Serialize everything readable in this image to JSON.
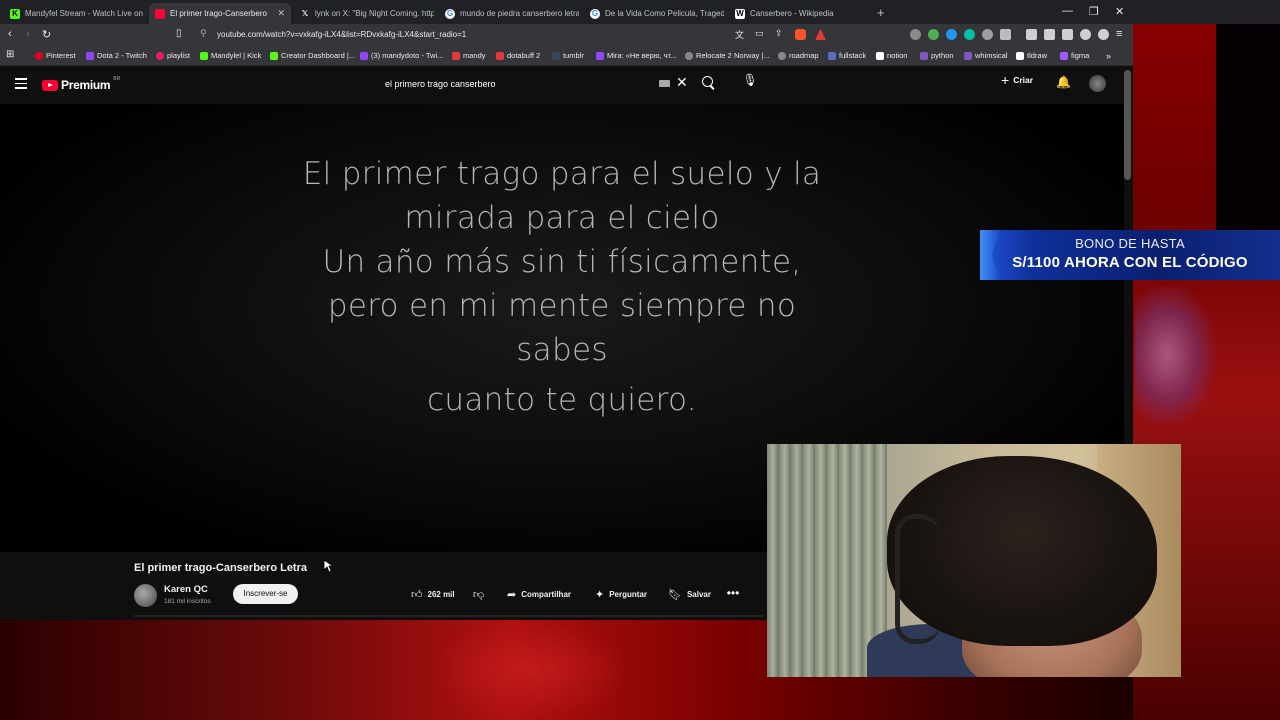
{
  "browser": {
    "tabs": [
      {
        "title": "Mandyfel Stream - Watch Live on Kick",
        "icon": "kick-icon",
        "color": "#53fc18"
      },
      {
        "title": "El primer trago-Canserbero Letra",
        "icon": "youtube-icon",
        "color": "#ff0033",
        "active": true
      },
      {
        "title": "lynk on X: \"Big Night Coming. https:",
        "icon": "x-icon",
        "color": "#ffffff"
      },
      {
        "title": "mundo de piedra canserbero letra -",
        "icon": "google-icon",
        "color": "#ffffff"
      },
      {
        "title": "De la Vida Como Pelicula, Tragedia, C",
        "icon": "google-icon",
        "color": "#ffffff"
      },
      {
        "title": "Canserbero - Wikipedia",
        "icon": "wikipedia-icon",
        "color": "#ffffff"
      }
    ],
    "url": "youtube.com/watch?v=vxkafg-iLX4&list=RDvxkafg-iLX4&start_radio=1",
    "bookmarks": [
      {
        "label": "Pinterest",
        "color": "#e60023"
      },
      {
        "label": "Dota 2 - Twitch",
        "color": "#9146ff"
      },
      {
        "label": "playlist",
        "color": "#e91e63"
      },
      {
        "label": "Mandylel | Kick",
        "color": "#53fc18"
      },
      {
        "label": "Creator Dashboard |...",
        "color": "#53fc18"
      },
      {
        "label": "(3) mandydoto - Twi...",
        "color": "#9146ff"
      },
      {
        "label": "mandy",
        "color": "#e53935"
      },
      {
        "label": "dotabuff 2",
        "color": "#e53935"
      },
      {
        "label": "tumblr",
        "color": "#36465d"
      },
      {
        "label": "Mira: «Не верю, чт...",
        "color": "#9146ff"
      },
      {
        "label": "Relocate 2 Norway |...",
        "color": "#888888"
      },
      {
        "label": "roadmap",
        "color": "#888888"
      },
      {
        "label": "fullstack",
        "color": "#5c6bc0"
      },
      {
        "label": "notion",
        "color": "#ffffff"
      },
      {
        "label": "python",
        "color": "#7e57c2"
      },
      {
        "label": "whimsical",
        "color": "#7e57c2"
      },
      {
        "label": "tldraw",
        "color": "#ffffff"
      },
      {
        "label": "figma",
        "color": "#a259ff"
      }
    ]
  },
  "youtube": {
    "logo_text": "Premium",
    "logo_region": "BR",
    "search_query": "el primero trago canserbero",
    "create_label": "Criar"
  },
  "video": {
    "lyrics": [
      "El primer trago para el suelo y la",
      "mirada para el cielo",
      "Un año más sin ti físicamente,",
      "pero en mi mente siempre no",
      "sabes",
      "cuanto te quiero."
    ],
    "title": "El primer trago-Canserbero Letra",
    "channel_name": "Karen QC",
    "subscribers": "181 mil inscritos",
    "subscribe_label": "Inscrever-se",
    "likes": "262 mil",
    "share_label": "Compartilhar",
    "ask_label": "Perguntar",
    "save_label": "Salvar"
  },
  "overlay": {
    "promo_line1": "BONO DE HASTA",
    "promo_line2": "S/1100 AHORA CON EL CÓDIGO"
  }
}
